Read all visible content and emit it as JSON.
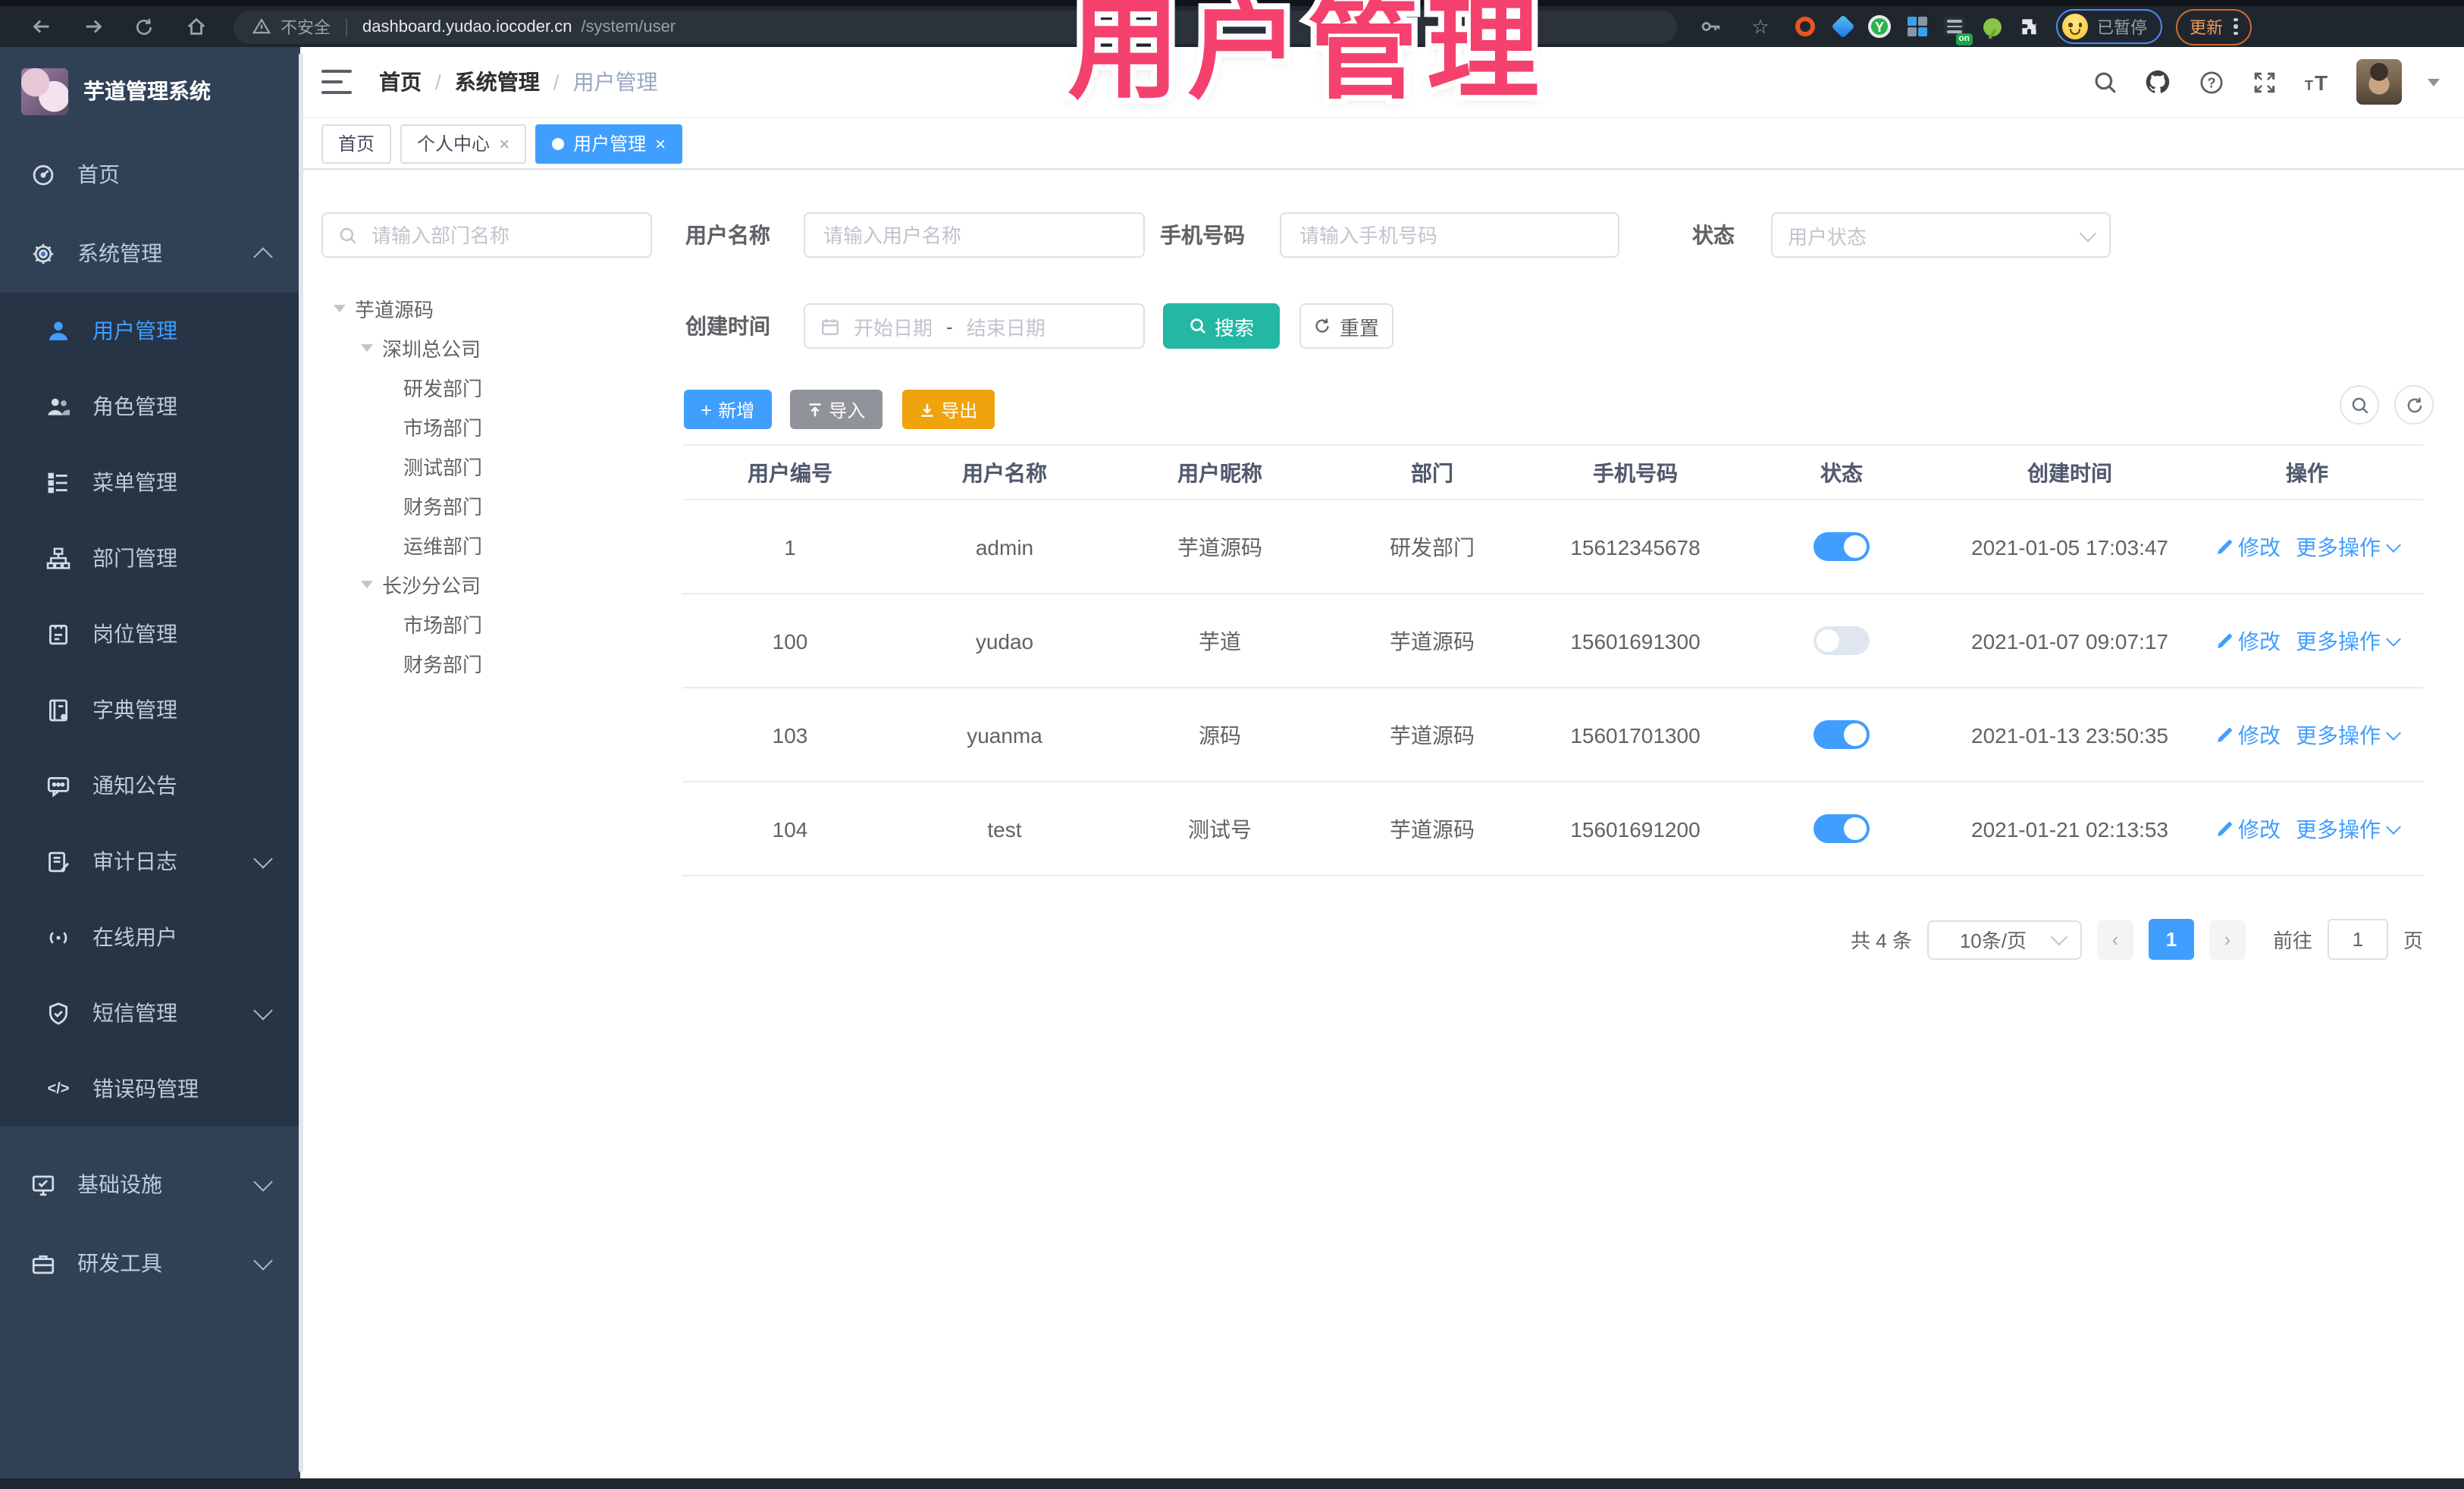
{
  "watermark": {
    "text": "用户管理",
    "color": "#f4416d"
  },
  "browser": {
    "security_label": "不安全",
    "url_host": "dashboard.yudao.iocoder.cn",
    "url_path": "/system/user",
    "extension_on_badge": "on",
    "yudao_badge": "Y",
    "profile_status": "已暂停",
    "update_label": "更新"
  },
  "sidebar": {
    "title": "芋道管理系统",
    "top": [
      {
        "label": "首页"
      },
      {
        "label": "系统管理"
      }
    ],
    "submenu": [
      {
        "label": "用户管理"
      },
      {
        "label": "角色管理"
      },
      {
        "label": "菜单管理"
      },
      {
        "label": "部门管理"
      },
      {
        "label": "岗位管理"
      },
      {
        "label": "字典管理"
      },
      {
        "label": "通知公告"
      },
      {
        "label": "审计日志"
      },
      {
        "label": "在线用户"
      },
      {
        "label": "短信管理"
      },
      {
        "label": "错误码管理"
      }
    ],
    "bottom": [
      {
        "label": "基础设施"
      },
      {
        "label": "研发工具"
      }
    ]
  },
  "header": {
    "breadcrumb": [
      "首页",
      "系统管理",
      "用户管理"
    ],
    "separator": "/"
  },
  "tabs": {
    "close_glyph": "×",
    "items": [
      {
        "label": "首页"
      },
      {
        "label": "个人中心"
      },
      {
        "label": "用户管理"
      }
    ]
  },
  "dept_panel": {
    "search_placeholder": "请输入部门名称",
    "tree": [
      {
        "label": "芋道源码"
      },
      {
        "label": "深圳总公司"
      },
      {
        "label": "研发部门"
      },
      {
        "label": "市场部门"
      },
      {
        "label": "测试部门"
      },
      {
        "label": "财务部门"
      },
      {
        "label": "运维部门"
      },
      {
        "label": "长沙分公司"
      },
      {
        "label": "市场部门"
      },
      {
        "label": "财务部门"
      }
    ]
  },
  "filters": {
    "username_label": "用户名称",
    "username_placeholder": "请输入用户名称",
    "mobile_label": "手机号码",
    "mobile_placeholder": "请输入手机号码",
    "status_label": "状态",
    "status_placeholder": "用户状态",
    "created_label": "创建时间",
    "date_start_placeholder": "开始日期",
    "date_separator": "-",
    "date_end_placeholder": "结束日期",
    "search_button": "搜索",
    "reset_button": "重置"
  },
  "toolbar": {
    "add": "新增",
    "import": "导入",
    "export": "导出"
  },
  "table": {
    "columns": [
      "用户编号",
      "用户名称",
      "用户昵称",
      "部门",
      "手机号码",
      "状态",
      "创建时间",
      "操作"
    ],
    "action_edit": "修改",
    "action_more": "更多操作",
    "rows": [
      {
        "id": "1",
        "username": "admin",
        "nickname": "芋道源码",
        "dept": "研发部门",
        "mobile": "15612345678",
        "status": "on",
        "created": "2021-01-05 17:03:47"
      },
      {
        "id": "100",
        "username": "yudao",
        "nickname": "芋道",
        "dept": "芋道源码",
        "mobile": "15601691300",
        "status": "off",
        "created": "2021-01-07 09:07:17"
      },
      {
        "id": "103",
        "username": "yuanma",
        "nickname": "源码",
        "dept": "芋道源码",
        "mobile": "15601701300",
        "status": "on",
        "created": "2021-01-13 23:50:35"
      },
      {
        "id": "104",
        "username": "test",
        "nickname": "测试号",
        "dept": "芋道源码",
        "mobile": "15601691200",
        "status": "on",
        "created": "2021-01-21 02:13:53"
      }
    ]
  },
  "pagination": {
    "total": "共 4 条",
    "page_size": "10条/页",
    "prev": "‹",
    "page": "1",
    "next": "›",
    "goto": "前往",
    "goto_value": "1",
    "unit": "页"
  }
}
